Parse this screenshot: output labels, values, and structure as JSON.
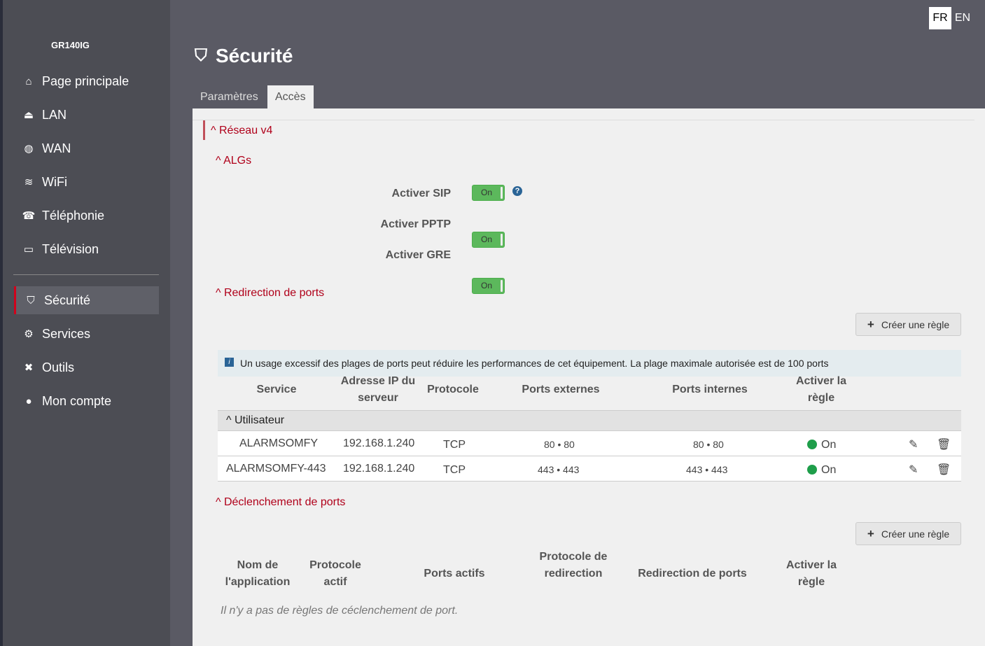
{
  "sidebar": {
    "brand": "GR140IG",
    "items": [
      {
        "label": "Page principale",
        "icon": "home-icon"
      },
      {
        "label": "LAN",
        "icon": "lan-icon"
      },
      {
        "label": "WAN",
        "icon": "globe-icon"
      },
      {
        "label": "WiFi",
        "icon": "wifi-icon"
      },
      {
        "label": "Téléphonie",
        "icon": "phone-icon"
      },
      {
        "label": "Télévision",
        "icon": "tv-icon"
      },
      {
        "label": "Sécurité",
        "icon": "shield-icon"
      },
      {
        "label": "Services",
        "icon": "gears-icon"
      },
      {
        "label": "Outils",
        "icon": "tools-icon"
      },
      {
        "label": "Mon compte",
        "icon": "user-icon"
      }
    ]
  },
  "lang": {
    "fr": "FR",
    "en": "EN"
  },
  "header": {
    "title": "Sécurité"
  },
  "tabs": [
    "Paramètres",
    "Accès"
  ],
  "sections": {
    "reseau": "Réseau v4",
    "algs": "ALGs",
    "redirection": "Redirection de ports",
    "declenchement": "Déclenchement de ports"
  },
  "algs": [
    {
      "label": "Activer SIP",
      "state": "On"
    },
    {
      "label": "Activer PPTP",
      "state": "On"
    },
    {
      "label": "Activer GRE",
      "state": "On"
    }
  ],
  "create_rule": "Créer une règle",
  "info": "Un usage excessif des plages de ports peut réduire les performances de cet équipement. La plage maximale autorisée est de 100 ports",
  "pf_table": {
    "headers": [
      "Service",
      "Adresse IP du serveur",
      "Protocole",
      "Ports externes",
      "Ports internes",
      "Activer la règle"
    ],
    "group": "Utilisateur",
    "rows": [
      {
        "service": "ALARMSOMFY",
        "ip": "192.168.1.240",
        "proto": "TCP",
        "ext": "80 • 80",
        "int": "80 • 80",
        "state": "On"
      },
      {
        "service": "ALARMSOMFY-443",
        "ip": "192.168.1.240",
        "proto": "TCP",
        "ext": "443 • 443",
        "int": "443 • 443",
        "state": "On"
      }
    ]
  },
  "pt_table": {
    "headers": [
      "Nom de l'application",
      "Protocole actif",
      "Ports actifs",
      "Protocole de redirection",
      "Redirection de ports",
      "Activer la règle"
    ],
    "empty": "Il n'y a pas de règles de céclenchement de port."
  }
}
